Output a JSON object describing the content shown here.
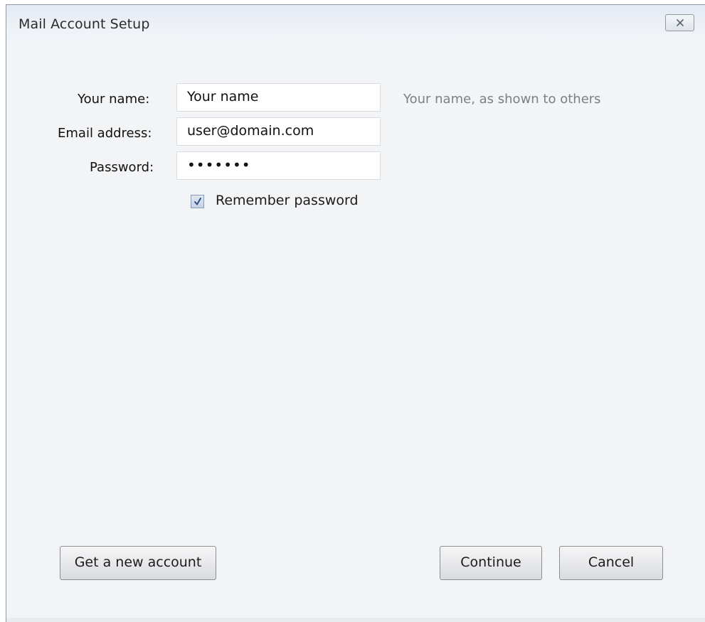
{
  "window": {
    "title": "Mail Account Setup",
    "close_icon": "close-icon"
  },
  "form": {
    "name": {
      "label": "Your name:",
      "value": "Your name",
      "hint": "Your name, as shown to others"
    },
    "email": {
      "label": "Email address:",
      "value": "user@domain.com"
    },
    "password": {
      "label": "Password:",
      "value": "•••••••"
    },
    "remember_password": {
      "label": "Remember password",
      "checked": true
    }
  },
  "buttons": {
    "get_new_account": "Get a new account",
    "continue": "Continue",
    "cancel": "Cancel"
  },
  "colors": {
    "window_background": "#f3f4f6",
    "titlebar": "#e3eaf3",
    "hint_text": "#7c7f85"
  }
}
